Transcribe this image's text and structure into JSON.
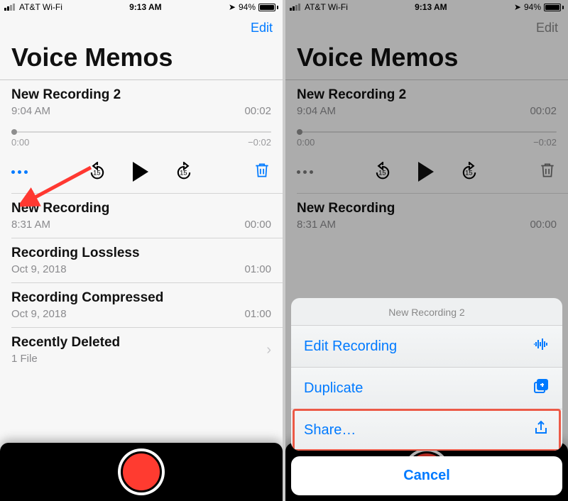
{
  "statusbar": {
    "carrier": "AT&T Wi-Fi",
    "time": "9:13 AM",
    "battery_pct": "94%"
  },
  "nav": {
    "edit": "Edit"
  },
  "app_title": "Voice Memos",
  "selected": {
    "title": "New Recording 2",
    "time": "9:04 AM",
    "duration": "00:02",
    "pos_start": "0:00",
    "pos_end": "−0:02"
  },
  "recordings": [
    {
      "title": "New Recording",
      "subtitle": "8:31 AM",
      "duration": "00:00"
    },
    {
      "title": "Recording Lossless",
      "subtitle": "Oct 9, 2018",
      "duration": "01:00"
    },
    {
      "title": "Recording Compressed",
      "subtitle": "Oct 9, 2018",
      "duration": "01:00"
    }
  ],
  "recently_deleted": {
    "title": "Recently Deleted",
    "subtitle": "1 File"
  },
  "sheet": {
    "title": "New Recording 2",
    "edit": "Edit Recording",
    "duplicate": "Duplicate",
    "share": "Share…",
    "cancel": "Cancel"
  }
}
